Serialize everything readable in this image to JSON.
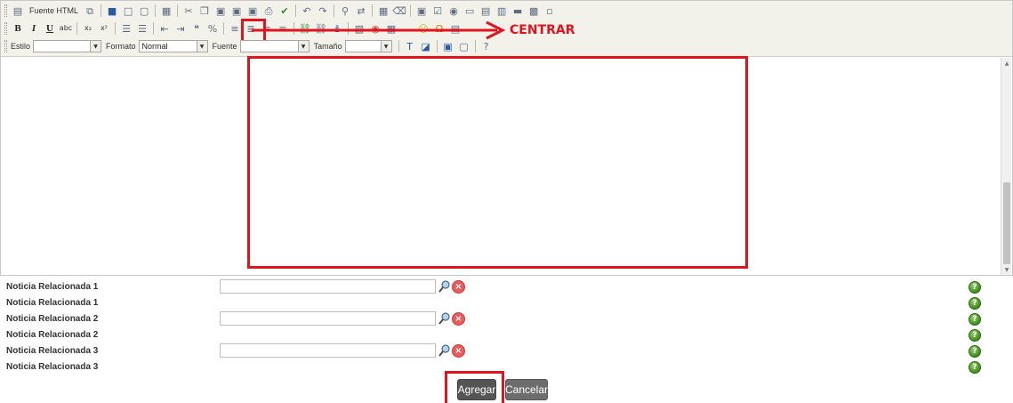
{
  "toolbar": {
    "row1": {
      "source_label": "Fuente HTML"
    },
    "row3": {
      "style_label": "Estilo",
      "style_value": "",
      "format_label": "Formato",
      "format_value": "Normal",
      "font_label": "Fuente",
      "font_value": "",
      "size_label": "Tamaño",
      "size_value": ""
    }
  },
  "annotation": {
    "label": "CENTRAR",
    "color": "#e0141f"
  },
  "form": {
    "rows": [
      {
        "label": "Noticia Relacionada 1",
        "has_input": true,
        "value": ""
      },
      {
        "label": "Noticia Relacionada 1",
        "has_input": false
      },
      {
        "label": "Noticia Relacionada 2",
        "has_input": true,
        "value": ""
      },
      {
        "label": "Noticia Relacionada 2",
        "has_input": false
      },
      {
        "label": "Noticia Relacionada 3",
        "has_input": true,
        "value": ""
      },
      {
        "label": "Noticia Relacionada 3",
        "has_input": false
      }
    ]
  },
  "actions": {
    "add_label": "Agregar",
    "cancel_label": "Cancelar"
  },
  "icons": {
    "help": "?",
    "clear": "×"
  }
}
